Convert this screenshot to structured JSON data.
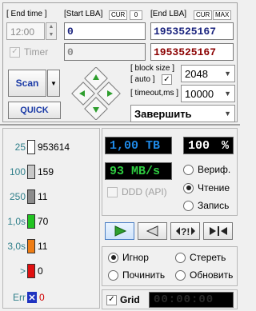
{
  "top": {
    "end_time_label": "[ End time ]",
    "end_time_value": "12:00",
    "timer_label": "Timer",
    "timer_checked": "✓",
    "start_lba_label": "[Start LBA]",
    "start_cur_tag": "CUR",
    "start_cur_value": "0",
    "start_lba_value": "0",
    "start_lba_value2": "0",
    "end_lba_label": "[End LBA]",
    "end_cur_tag": "CUR",
    "end_max_tag": "MAX",
    "end_lba_value": "1953525167",
    "end_lba_value2": "1953525167",
    "scan_label": "Scan",
    "quick_label": "QUICK",
    "block_size_label": "[ block size ]",
    "auto_label": "[ auto ]",
    "auto_checked": "✓",
    "block_size_value": "2048",
    "timeout_label": "[ timeout,ms ]",
    "timeout_value": "10000",
    "action_value": "Завершить"
  },
  "legend": [
    {
      "label": "25",
      "count": "953614",
      "color": "#ffffff"
    },
    {
      "label": "100",
      "count": "159",
      "color": "#c8c8c8"
    },
    {
      "label": "250",
      "count": "11",
      "color": "#8c8c8c"
    },
    {
      "label": "1,0s",
      "count": "70",
      "color": "#22c322"
    },
    {
      "label": "3,0s",
      "count": "11",
      "color": "#ef7d14"
    },
    {
      "label": ">",
      "count": "0",
      "color": "#e01010"
    }
  ],
  "err": {
    "label": "Err",
    "icon": "✕",
    "count": "0"
  },
  "stats": {
    "size": "1,00 TB",
    "percent": "100",
    "percent_sign": "%",
    "speed": "93 MB/s",
    "ddd_label": "DDD (API)"
  },
  "modes": {
    "verify": "Вериф.",
    "read": "Чтение",
    "write": "Запись"
  },
  "actions": {
    "ignore": "Игнор",
    "erase": "Стереть",
    "repair": "Починить",
    "refresh": "Обновить"
  },
  "grid": {
    "label": "Grid",
    "checked": "✓",
    "timer": "00:00:00"
  },
  "colors": {
    "lcd_blue": "#1e88e5",
    "lcd_green": "#2ecc40",
    "lcd_white": "#ffffff",
    "lba_blue": "#1a237e",
    "lba_red": "#8b0000",
    "arrow_green": "#2e9e2e"
  }
}
